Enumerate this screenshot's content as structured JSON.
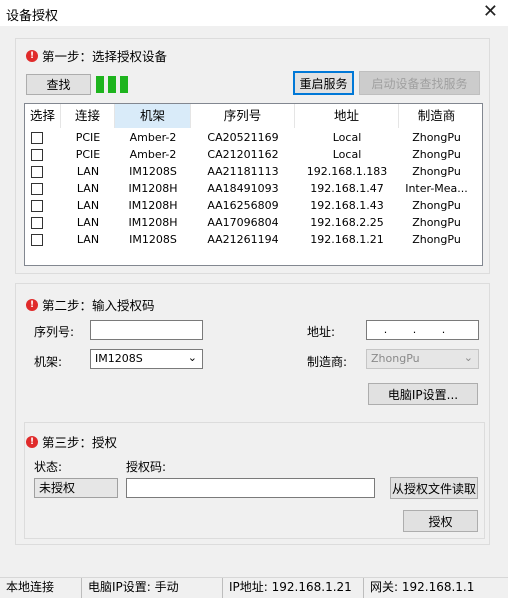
{
  "window": {
    "title": "设备授权",
    "close_glyph": "✕"
  },
  "step1": {
    "title": "第一步：选择授权设备",
    "search_label": "查找",
    "restart_label": "重启服务",
    "start_search_service_label": "启动设备查找服务",
    "columns": [
      "选择",
      "连接",
      "机架",
      "序列号",
      "地址",
      "制造商"
    ],
    "rows": [
      {
        "conn": "PCIE",
        "rack": "Amber-2",
        "serial": "CA20521169",
        "addr": "Local",
        "maker": "ZhongPu"
      },
      {
        "conn": "PCIE",
        "rack": "Amber-2",
        "serial": "CA21201162",
        "addr": "Local",
        "maker": "ZhongPu"
      },
      {
        "conn": "LAN",
        "rack": "IM1208S",
        "serial": "AA21181113",
        "addr": "192.168.1.183",
        "maker": "ZhongPu"
      },
      {
        "conn": "LAN",
        "rack": "IM1208H",
        "serial": "AA18491093",
        "addr": "192.168.1.47",
        "maker": "Inter-Mea..."
      },
      {
        "conn": "LAN",
        "rack": "IM1208H",
        "serial": "AA16256809",
        "addr": "192.168.1.43",
        "maker": "ZhongPu"
      },
      {
        "conn": "LAN",
        "rack": "IM1208H",
        "serial": "AA17096804",
        "addr": "192.168.2.25",
        "maker": "ZhongPu"
      },
      {
        "conn": "LAN",
        "rack": "IM1208S",
        "serial": "AA21261194",
        "addr": "192.168.1.21",
        "maker": "ZhongPu"
      }
    ]
  },
  "step2": {
    "title": "第二步：输入授权码",
    "serial_label": "序列号:",
    "serial_value": "",
    "address_label": "地址:",
    "address_dots": [
      ".",
      ".",
      "."
    ],
    "rack_label": "机架:",
    "rack_value": "IM1208S",
    "maker_label": "制造商:",
    "maker_value": "ZhongPu",
    "pc_ip_button": "电脑IP设置..."
  },
  "step3": {
    "title": "第三步：授权",
    "status_label": "状态:",
    "status_value": "未授权",
    "code_label": "授权码:",
    "code_value": "",
    "read_file_button": "从授权文件读取",
    "authorize_button": "授权"
  },
  "statusbar": {
    "connection": "本地连接",
    "pc_ip_mode": "电脑IP设置: 手动",
    "ip_address": "IP地址: 192.168.1.21",
    "gateway": "网关: 192.168.1.1"
  },
  "colors": {
    "indicator": "#1eb41e",
    "warn": "#e02b2b",
    "focus_border": "#0078d7"
  }
}
